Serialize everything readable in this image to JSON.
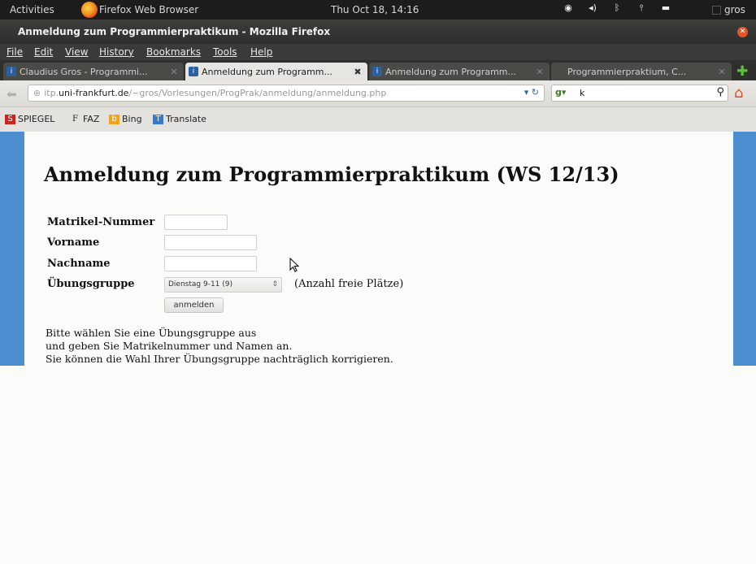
{
  "topbar": {
    "activities": "Activities",
    "app_name": "Firefox Web Browser",
    "clock": "Thu Oct 18, 14:16",
    "user": "gros"
  },
  "window": {
    "title": "Anmeldung zum Programmierpraktikum - Mozilla Firefox"
  },
  "menubar": {
    "items": [
      "File",
      "Edit",
      "View",
      "History",
      "Bookmarks",
      "Tools",
      "Help"
    ]
  },
  "tabs": [
    {
      "label": "Claudius Gros - Programmi...",
      "active": false
    },
    {
      "label": "Anmeldung zum Programm...",
      "active": true
    },
    {
      "label": "Anmeldung zum Programm...",
      "active": false
    },
    {
      "label": "Programmierpraktium, C...",
      "active": false
    }
  ],
  "navbar": {
    "url_prefix": "itp.",
    "url_domain": "uni-frankfurt.de",
    "url_path": "/~gros/Vorlesungen/ProgPrak/anmeldung/anmeldung.php",
    "search_value": "k"
  },
  "bookmarks": [
    "SPIEGEL",
    "FAZ",
    "Bing",
    "Translate"
  ],
  "page": {
    "heading": "Anmeldung zum Programmierpraktikum (WS 12/13)",
    "form": {
      "matrikel_label": "Matrikel-Nummer",
      "vorname_label": "Vorname",
      "nachname_label": "Nachname",
      "gruppe_label": "Übungsgruppe",
      "gruppe_selected": "Dienstag 9-11 (9)",
      "gruppe_hint": "(Anzahl freie Plätze)",
      "submit_label": "anmelden"
    },
    "instructions": [
      "Bitte wählen Sie eine Übungsgruppe aus",
      "und geben Sie Matrikelnummer und Namen an.",
      "Sie können die Wahl Ihrer Übungsgruppe nachträglich korrigieren."
    ]
  },
  "colors": {
    "page_band": "#4d8ed0",
    "topbar": "#1c1c1c",
    "window_chrome": "#3a3a38"
  }
}
